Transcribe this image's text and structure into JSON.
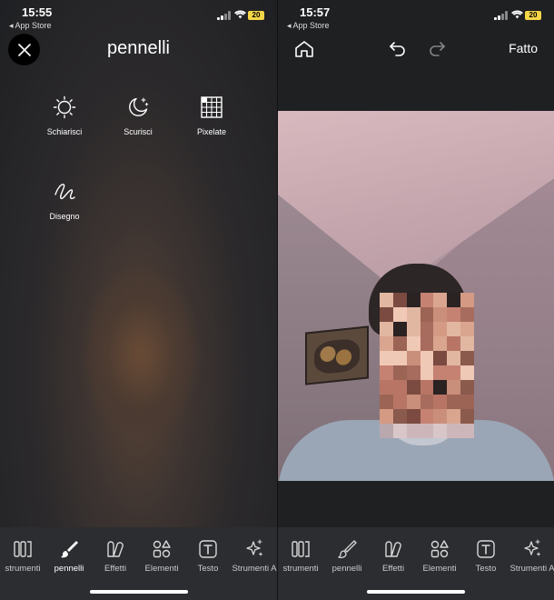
{
  "left": {
    "status": {
      "time": "15:55",
      "back": "◂ App Store",
      "battery": "20"
    },
    "title": "pennelli",
    "tools": [
      {
        "label": "Schiarisci",
        "icon": "sun-icon"
      },
      {
        "label": "Scurisci",
        "icon": "moon-icon"
      },
      {
        "label": "Pixelate",
        "icon": "grid-icon"
      },
      {
        "label": "Disegno",
        "icon": "scribble-icon"
      }
    ],
    "tabs": [
      {
        "label": "strumenti",
        "icon": "tools-icon"
      },
      {
        "label": "pennelli",
        "icon": "brush-icon",
        "active": true
      },
      {
        "label": "Effetti",
        "icon": "effects-icon"
      },
      {
        "label": "Elementi",
        "icon": "elements-icon"
      },
      {
        "label": "Testo",
        "icon": "text-icon"
      },
      {
        "label": "Strumenti A",
        "icon": "sparkle-icon"
      }
    ]
  },
  "right": {
    "status": {
      "time": "15:57",
      "back": "◂ App Store",
      "battery": "20"
    },
    "done_label": "Fatto",
    "tabs": [
      {
        "label": "strumenti",
        "icon": "tools-icon"
      },
      {
        "label": "pennelli",
        "icon": "brush-icon"
      },
      {
        "label": "Effetti",
        "icon": "effects-icon"
      },
      {
        "label": "Elementi",
        "icon": "elements-icon"
      },
      {
        "label": "Testo",
        "icon": "text-icon"
      },
      {
        "label": "Strumenti A",
        "icon": "sparkle-icon"
      }
    ]
  },
  "colors": {
    "battery": "#f5d547",
    "tabbar": "#2b2d30",
    "background": "#1e2022"
  }
}
